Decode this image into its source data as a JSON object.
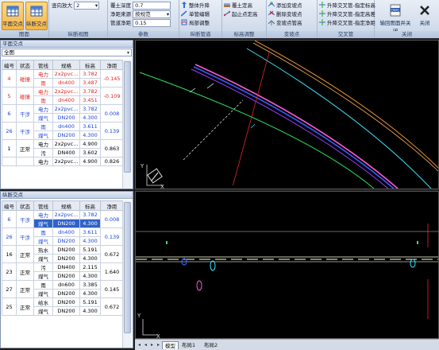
{
  "ribbon": {
    "groups": [
      {
        "title": "图面"
      },
      {
        "title": "纵断视图"
      },
      {
        "title": "参数"
      },
      {
        "title": "纵断管道"
      },
      {
        "title": "标高调整"
      },
      {
        "title": "变坡点"
      },
      {
        "title": "交叉管"
      },
      {
        "title": "关闭"
      }
    ],
    "btn_plan_cross": "平面交点",
    "btn_profile_cross": "纵断交点",
    "vscale_label": "竖向放大",
    "vscale_value": "2",
    "cover_depth_label": "覆土深度",
    "cover_depth_value": "0.7",
    "clear_src_label": "净距来源",
    "clear_src_value": "按规范",
    "min_clear_label": "管道净距",
    "min_clear_value": "0.15",
    "pipe_lift": "整体升降",
    "pipe_single": "单管编辑",
    "pipe_local": "局部调整",
    "elev_cover": "覆土定高",
    "elev_start": "起止点定高",
    "vp_add": "添加变坡点",
    "vp_del": "删除变坡点",
    "vp_pipe": "变坡点管高",
    "cross_lift": "升降交叉管-指定标高",
    "cross_lift2": "升降交叉管-指定高差",
    "cross_lift3": "升降交叉管-指定净距",
    "export_label": "输回图面并关闭",
    "close_label": "关闭"
  },
  "plan_panel": {
    "title": "平面交点",
    "filter": "全图",
    "columns": [
      "编号",
      "状态",
      "管线",
      "规格",
      "标高",
      "净距"
    ],
    "rows": [
      {
        "id": "4",
        "status": "碰撞",
        "color": "red",
        "pipes": [
          [
            "电力",
            "2x2pvc...",
            "3.782"
          ],
          [
            "雨",
            "dn400",
            "3.487"
          ]
        ],
        "gap": "-0.145"
      },
      {
        "id": "5",
        "status": "碰撞",
        "color": "red",
        "pipes": [
          [
            "电力",
            "2x2pvc...",
            "3.782"
          ],
          [
            "雨",
            "dn400",
            "3.451"
          ]
        ],
        "gap": "-0.109"
      },
      {
        "id": "6",
        "status": "干涉",
        "color": "blue",
        "pipes": [
          [
            "电力",
            "2x2pvc...",
            "3.782"
          ],
          [
            "煤气",
            "DN200",
            "4.300"
          ]
        ],
        "gap": "0.008"
      },
      {
        "id": "26",
        "status": "干涉",
        "color": "blue",
        "pipes": [
          [
            "雨",
            "dn400",
            "3.611"
          ],
          [
            "煤气",
            "DN200",
            "4.300"
          ]
        ],
        "gap": "0.139"
      },
      {
        "id": "1",
        "status": "正常",
        "color": "black",
        "pipes": [
          [
            "电力",
            "2x2pvc...",
            "4.900"
          ],
          [
            "污",
            "DN400",
            "3.602"
          ]
        ],
        "gap": "0.863"
      },
      {
        "id": "",
        "status": "",
        "color": "black",
        "pipes": [
          [
            "电力",
            "2x2pvc...",
            "4.900"
          ]
        ],
        "gap": "0.826"
      }
    ]
  },
  "profile_panel": {
    "title": "纵断交点",
    "columns": [
      "编号",
      "状态",
      "管线",
      "规格",
      "标高",
      "净距"
    ],
    "rows": [
      {
        "id": "6",
        "status": "干涉",
        "color": "blue",
        "pipes": [
          [
            "电力",
            "2x2pvc...",
            "3.782"
          ],
          [
            "煤气",
            "DN200",
            "4.300"
          ]
        ],
        "gap": "0.008"
      },
      {
        "id": "26",
        "status": "干涉",
        "color": "blue",
        "pipes": [
          [
            "雨",
            "dn400",
            "3.611"
          ],
          [
            "煤气",
            "DN200",
            "4.300"
          ]
        ],
        "gap": "0.139"
      },
      {
        "id": "16",
        "status": "正常",
        "color": "black",
        "pipes": [
          [
            "热水",
            "DN200",
            "5.191"
          ],
          [
            "煤气",
            "DN200",
            "4.300"
          ]
        ],
        "gap": "0.672"
      },
      {
        "id": "23",
        "status": "正常",
        "color": "black",
        "pipes": [
          [
            "污",
            "DN400",
            "2.115"
          ],
          [
            "煤气",
            "DN200",
            "4.300"
          ]
        ],
        "gap": "1.640"
      },
      {
        "id": "27",
        "status": "正常",
        "color": "black",
        "pipes": [
          [
            "雨",
            "dn600",
            "3.385"
          ],
          [
            "煤气",
            "DN200",
            "4.300"
          ]
        ],
        "gap": "0.145"
      },
      {
        "id": "25",
        "status": "正常",
        "color": "black",
        "pipes": [
          [
            "给水",
            "DN200",
            "5.191"
          ],
          [
            "煤气",
            "DN200",
            "4.300"
          ]
        ],
        "gap": "0.672"
      }
    ]
  },
  "layout_tabs": [
    "模型",
    "布局1",
    "布局2"
  ],
  "axis": {
    "x": "X",
    "y": "Y"
  }
}
